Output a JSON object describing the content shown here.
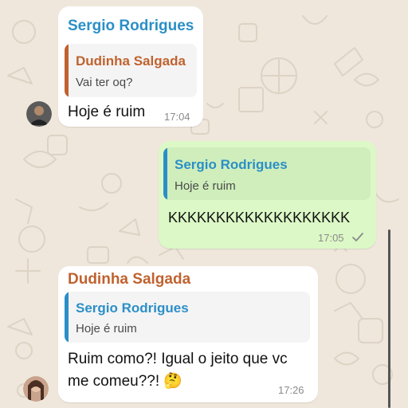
{
  "colors": {
    "background": "#efe7dc",
    "incoming_bubble": "#ffffff",
    "outgoing_bubble": "#dcf8c6",
    "sergio_name": "#2b8fc7",
    "dudinha_name": "#c0622f",
    "quote_bg_in": "#f4f4f4",
    "quote_bg_out": "#cfeebb"
  },
  "messages": [
    {
      "sender": "Sergio Rodrigues",
      "quoted_sender": "Dudinha Salgada",
      "quoted_text": "Vai ter oq?",
      "text": "Hoje é ruim",
      "time": "17:04",
      "avatar": "avatar-icon"
    },
    {
      "quoted_sender": "Sergio Rodrigues",
      "quoted_text": "Hoje é ruim",
      "text": "KKKKKKKKKKKKKKKKKKK",
      "time": "17:05",
      "status_icon": "check-icon"
    },
    {
      "sender": "Dudinha Salgada",
      "quoted_sender": "Sergio Rodrigues",
      "quoted_text": "Hoje é ruim",
      "text_line1": "Ruim como?! Igual o jeito que vc",
      "text_line2": "me comeu??!",
      "emoji": "🤔",
      "time": "17:26",
      "avatar": "avatar-icon"
    }
  ]
}
